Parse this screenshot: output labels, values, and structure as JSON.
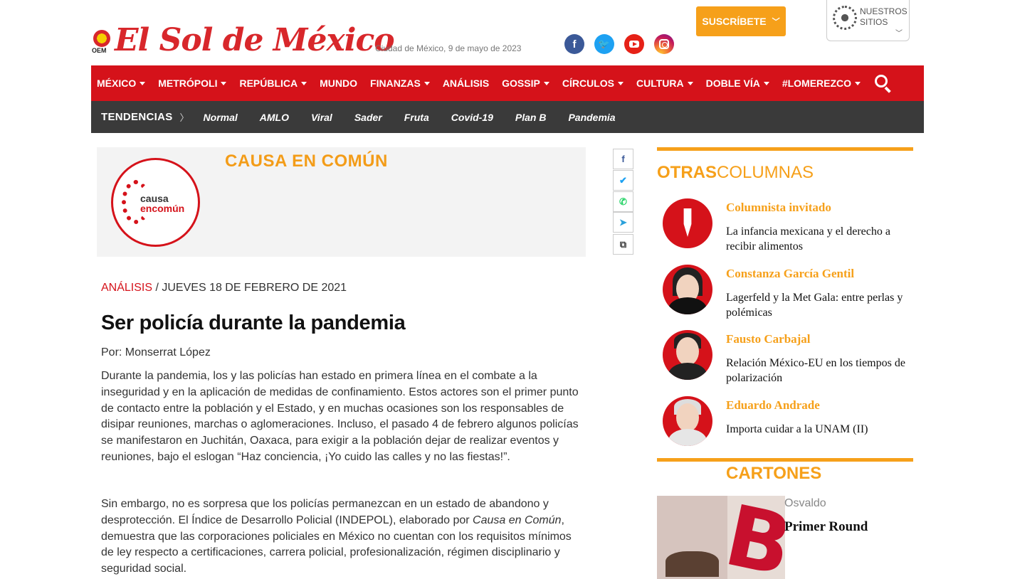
{
  "header": {
    "logo_text": "El Sol de México",
    "logo_badge": "OEM",
    "date": "Ciudad de México, 9 de mayo de 2023",
    "social_icons": [
      "facebook-icon",
      "twitter-icon",
      "youtube-icon",
      "instagram-icon"
    ],
    "subscribe_label": "SUSCRÍBETE",
    "sites_label_1": "NUESTROS",
    "sites_label_2": "SITIOS"
  },
  "nav": {
    "items": [
      {
        "label": "MÉXICO",
        "dropdown": true
      },
      {
        "label": "METRÓPOLI",
        "dropdown": true
      },
      {
        "label": "REPÚBLICA",
        "dropdown": true
      },
      {
        "label": "MUNDO",
        "dropdown": false
      },
      {
        "label": "FINANZAS",
        "dropdown": true
      },
      {
        "label": "ANÁLISIS",
        "dropdown": false
      },
      {
        "label": "GOSSIP",
        "dropdown": true
      },
      {
        "label": "CÍRCULOS",
        "dropdown": true
      },
      {
        "label": "CULTURA",
        "dropdown": true
      },
      {
        "label": "DOBLE VÍA",
        "dropdown": true
      },
      {
        "label": "#LOMEREZCO",
        "dropdown": true
      }
    ]
  },
  "trends": {
    "label": "TENDENCIAS",
    "items": [
      "Normal",
      "AMLO",
      "Viral",
      "Sader",
      "Fruta",
      "Covid-19",
      "Plan B",
      "Pandemia"
    ]
  },
  "banner": {
    "title": "CAUSA EN COMÚN",
    "logo_line1": "causa",
    "logo_line2": "encomún"
  },
  "share": {
    "icons": [
      "facebook-icon",
      "twitter-icon",
      "whatsapp-icon",
      "telegram-icon",
      "copy-link-icon"
    ]
  },
  "article": {
    "category": "ANÁLISIS",
    "date": "/ JUEVES 18 DE FEBRERO DE 2021",
    "headline": "Ser policía durante la pandemia",
    "byline": "Por: Monserrat López",
    "p1": "Durante la pandemia, los y las policías han estado en primera línea en el combate a la inseguridad y en la aplicación de medidas de confinamiento. Estos actores son el primer punto de contacto entre la población y el Estado, y en muchas ocasiones son los responsables de disipar reuniones, marchas o aglomeraciones. Incluso, el pasado 4 de febrero algunos policías se manifestaron en Juchitán, Oaxaca, para exigir a la población dejar de realizar eventos y reuniones, bajo el eslogan “Haz conciencia, ¡Yo cuido las calles y no las fiestas!”.",
    "p2_before": "Sin embargo, no es sorpresa que los policías permanezcan en un estado de abandono y desprotección. El Índice de Desarrollo Policial (INDEPOL), elaborado por ",
    "p2_em": "Causa en Común",
    "p2_after": ", demuestra que las corporaciones policiales en México no cuentan con los requisitos mínimos de ley respecto a certificaciones, carrera policial, profesionalización, régimen disciplinario y seguridad social."
  },
  "sidebar": {
    "heading_bold": "OTRAS",
    "heading_rest": "COLUMNAS",
    "columns": [
      {
        "author": "Columnista invitado",
        "title": "La infancia mexicana y el derecho a recibir alimentos"
      },
      {
        "author": "Constanza García Gentil",
        "title": "Lagerfeld y la Met Gala: entre perlas y polémicas"
      },
      {
        "author": "Fausto Carbajal",
        "title": "Relación México-EU en los tiempos de polarización"
      },
      {
        "author": "Eduardo Andrade",
        "title": "Importa cuidar a la UNAM (II)"
      }
    ],
    "cartoons_heading": "CARTONES",
    "cartoon_author": "Osvaldo",
    "cartoon_title": "Primer Round"
  }
}
